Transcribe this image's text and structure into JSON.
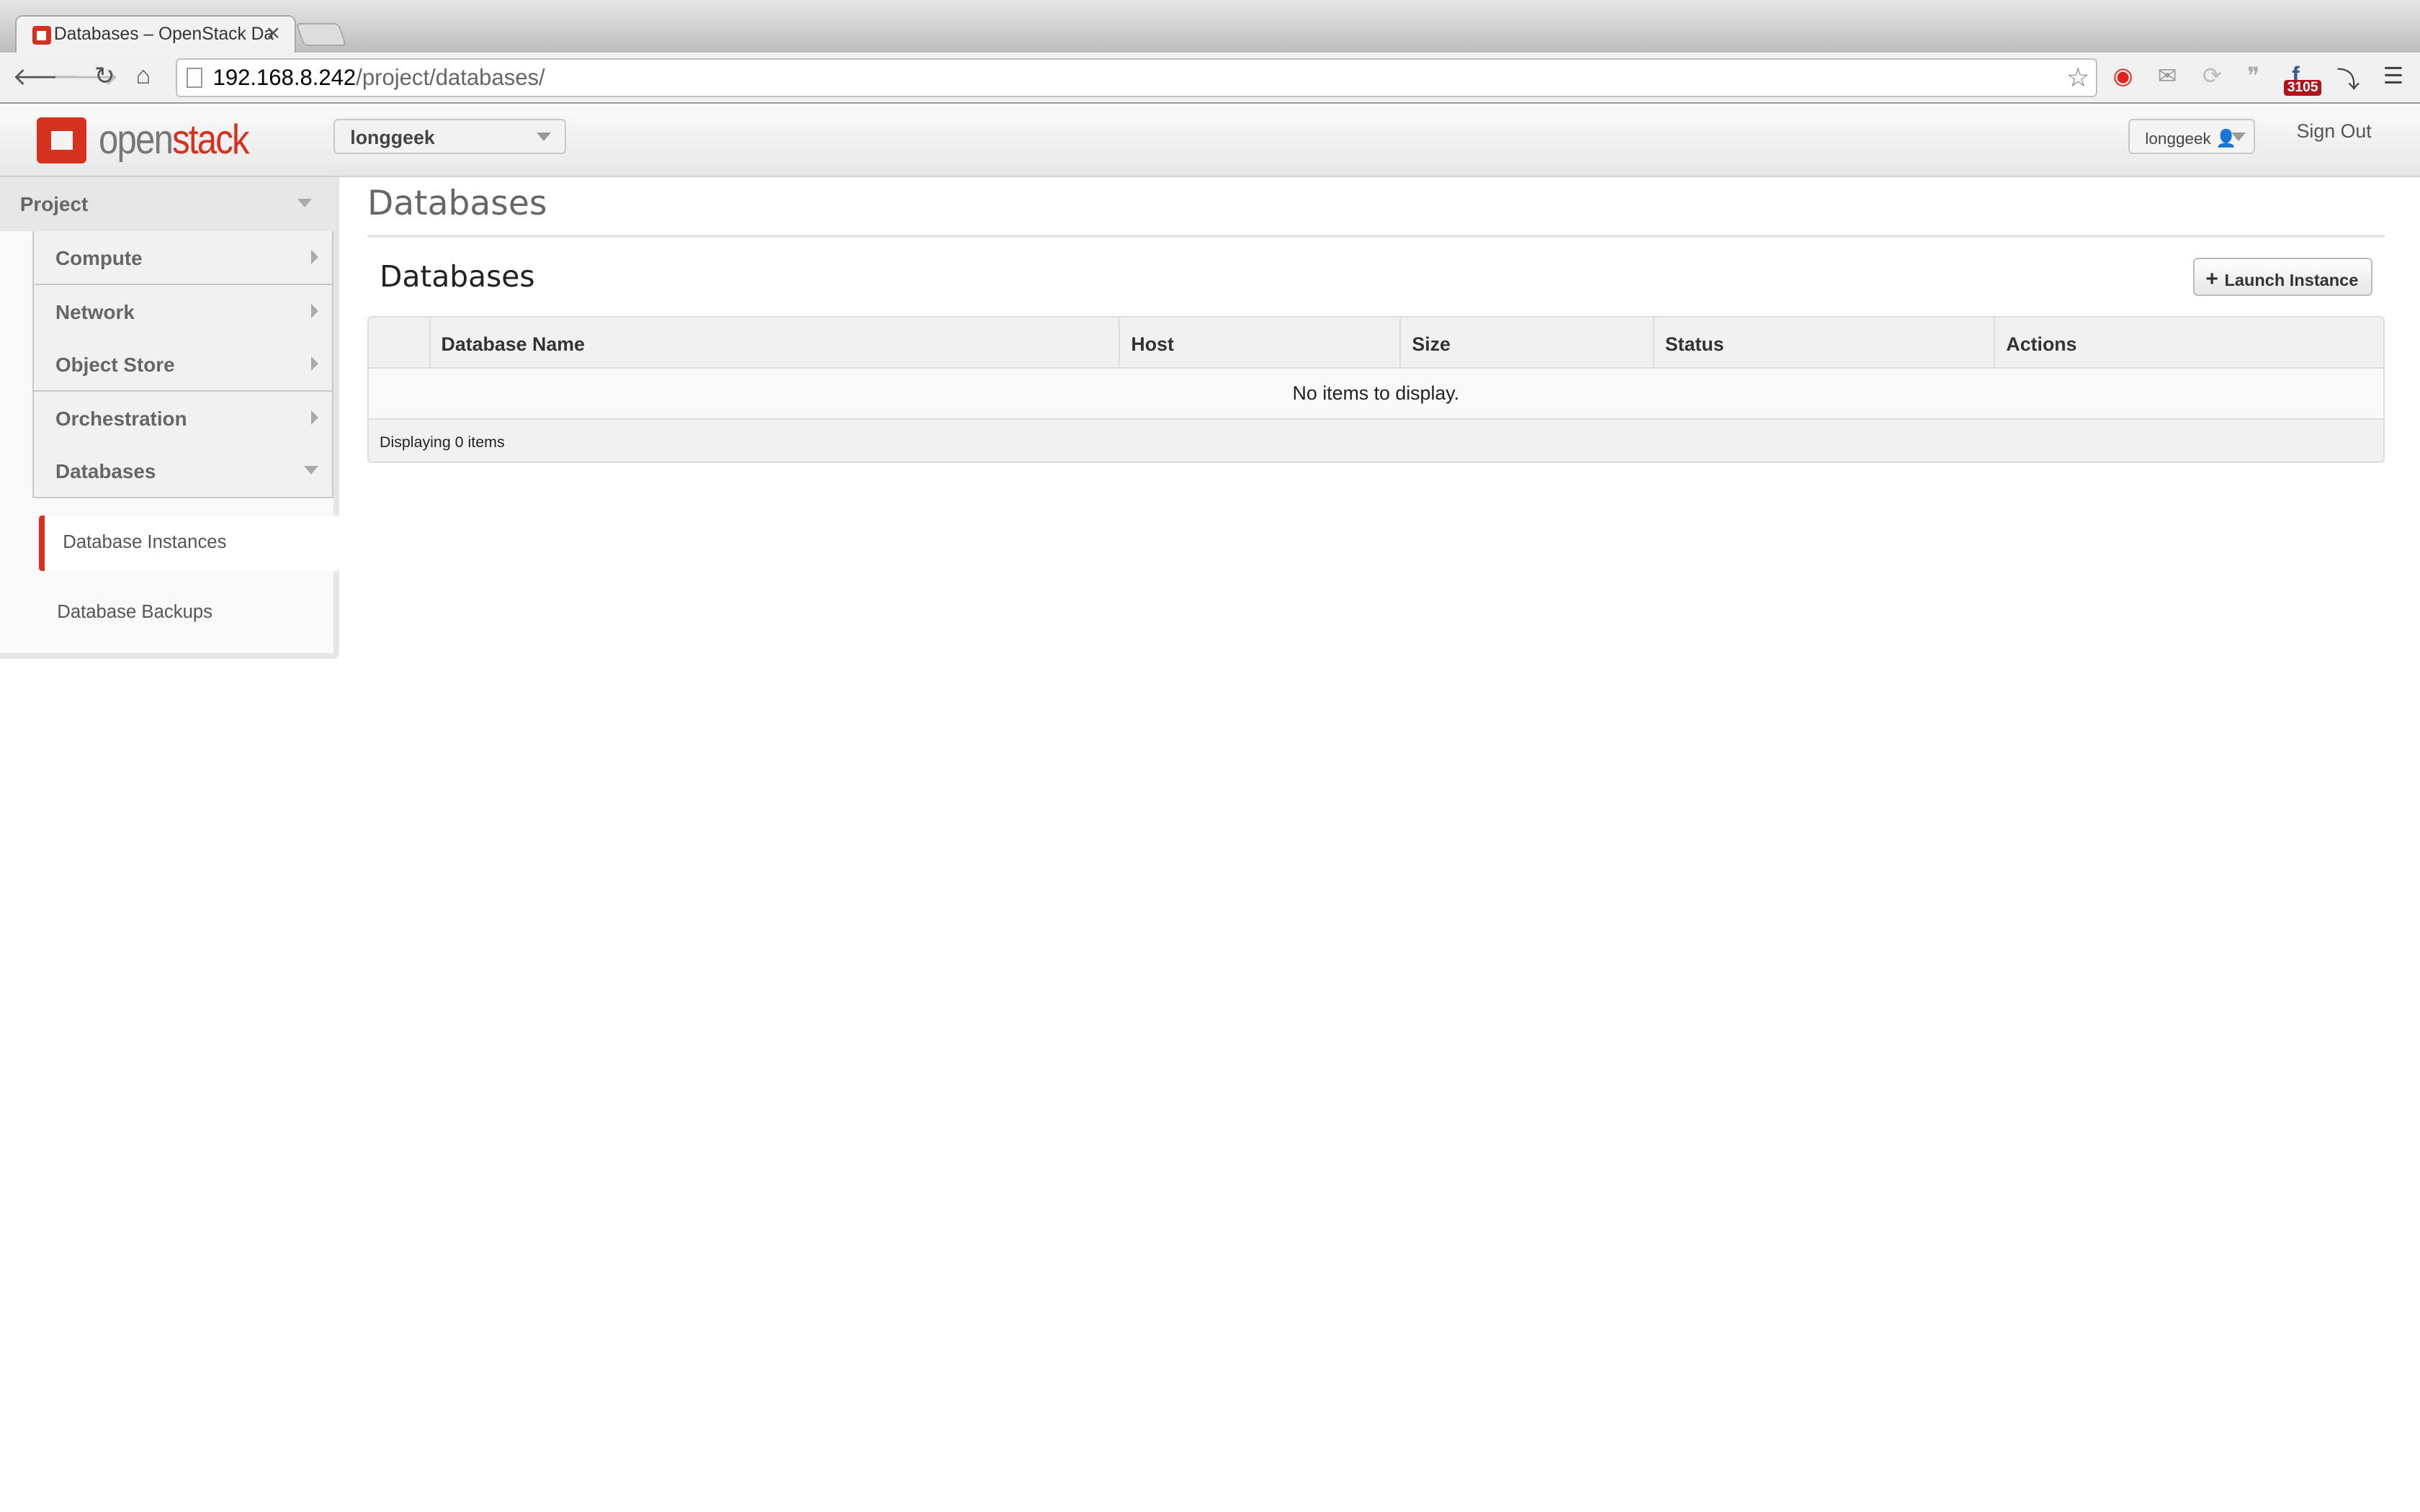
{
  "browser": {
    "tab_title": "Databases – OpenStack Da",
    "url_host": "192.168.8.242",
    "url_path": "/project/databases/",
    "extensions": [
      "weibo-icon",
      "gmail-icon",
      "sync-icon",
      "quote-icon",
      "facebook-icon",
      "download-icon",
      "menu-icon"
    ],
    "extension_badge": "3105"
  },
  "header": {
    "logo_open": "open",
    "logo_stack": "stack",
    "project_selector": "longgeek",
    "user_menu": "longgeek",
    "sign_out": "Sign Out"
  },
  "sidebar": {
    "section": "Project",
    "groups": [
      {
        "label": "Compute",
        "expanded": false
      },
      {
        "label": "Network",
        "expanded": false
      },
      {
        "label": "Object Store",
        "expanded": false
      },
      {
        "label": "Orchestration",
        "expanded": false
      },
      {
        "label": "Databases",
        "expanded": true
      }
    ],
    "items": [
      {
        "label": "Database Instances",
        "active": true
      },
      {
        "label": "Database Backups",
        "active": false
      }
    ]
  },
  "main": {
    "page_title": "Databases",
    "table_title": "Databases",
    "launch_button": "Launch Instance",
    "columns": [
      "",
      "Database Name",
      "Host",
      "Size",
      "Status",
      "Actions"
    ],
    "empty_message": "No items to display.",
    "footer": "Displaying 0 items"
  },
  "colors": {
    "accent": "#d6301e"
  }
}
